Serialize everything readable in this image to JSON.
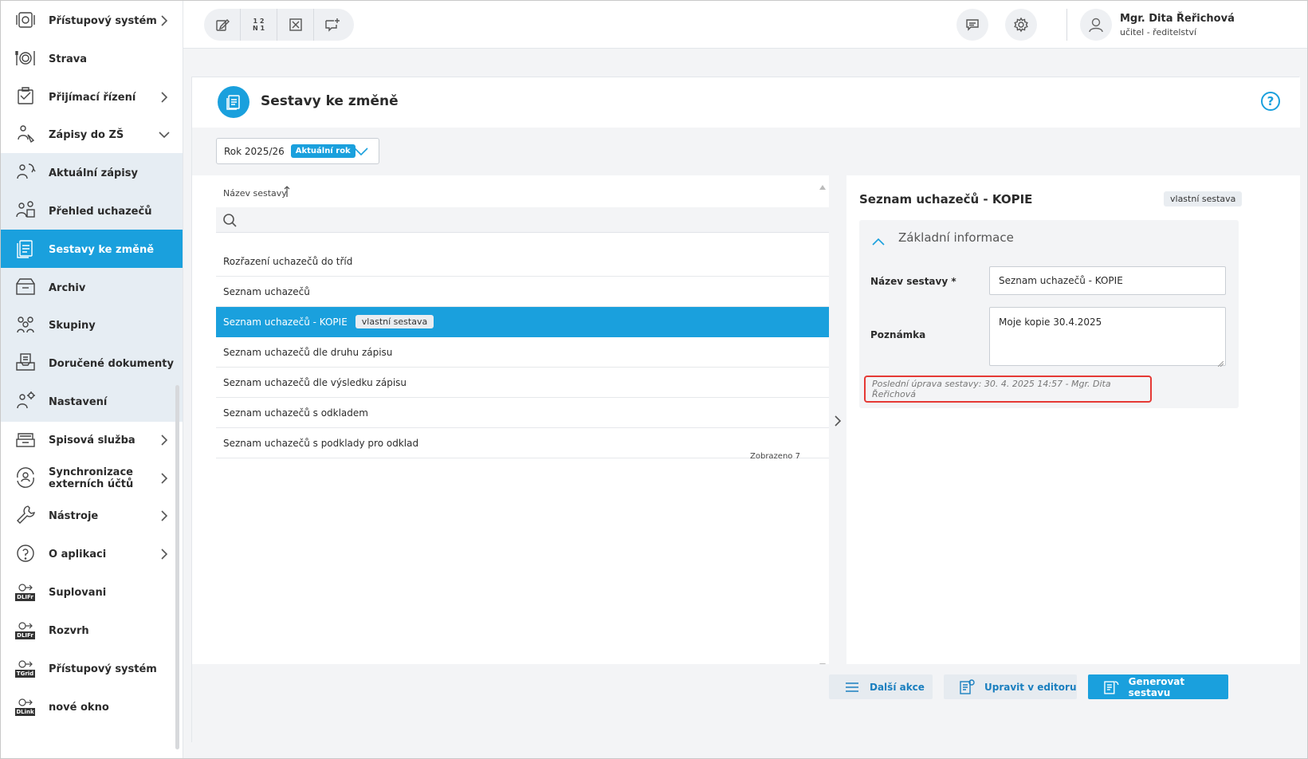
{
  "sidebar": {
    "items": [
      {
        "label": "Přístupový systém",
        "icon": "access-system-icon",
        "chevron": "right",
        "state": "normal"
      },
      {
        "label": "Strava",
        "icon": "meal-plate-icon",
        "chevron": "",
        "state": "normal"
      },
      {
        "label": "Přijímací řízení",
        "icon": "admission-icon",
        "chevron": "right",
        "state": "normal"
      },
      {
        "label": "Zápisy do ZŠ",
        "icon": "enrollment-icon",
        "chevron": "down",
        "state": "normal"
      },
      {
        "label": "Aktuální zápisy",
        "icon": "current-enrollment-icon",
        "chevron": "",
        "state": "sub"
      },
      {
        "label": "Přehled uchazečů",
        "icon": "applicants-overview-icon",
        "chevron": "",
        "state": "sub"
      },
      {
        "label": "Sestavy ke změně",
        "icon": "report-icon",
        "chevron": "",
        "state": "active"
      },
      {
        "label": "Archiv",
        "icon": "archive-icon",
        "chevron": "",
        "state": "sub"
      },
      {
        "label": "Skupiny",
        "icon": "groups-icon",
        "chevron": "",
        "state": "sub"
      },
      {
        "label": "Doručené dokumenty",
        "icon": "inbox-documents-icon",
        "chevron": "",
        "state": "sub"
      },
      {
        "label": "Nastavení",
        "icon": "settings-user-icon",
        "chevron": "",
        "state": "sub"
      },
      {
        "label": "Spisová služba",
        "icon": "filing-service-icon",
        "chevron": "right",
        "state": "normal"
      },
      {
        "label": "Synchronizace externích účtů",
        "icon": "sync-accounts-icon",
        "chevron": "right",
        "state": "normal"
      },
      {
        "label": "Nástroje",
        "icon": "wrench-icon",
        "chevron": "right",
        "state": "normal"
      },
      {
        "label": "O aplikaci",
        "icon": "question-icon",
        "chevron": "right",
        "state": "normal"
      },
      {
        "label": "Suplovani",
        "icon": "dlifr-icon",
        "chevron": "",
        "state": "normal",
        "badge": "DLIFr"
      },
      {
        "label": "Rozvrh",
        "icon": "dlifr-icon",
        "chevron": "",
        "state": "normal",
        "badge": "DLIFr"
      },
      {
        "label": "Přístupový systém",
        "icon": "tgrid-icon",
        "chevron": "",
        "state": "normal",
        "badge": "TGrid"
      },
      {
        "label": "nové okno",
        "icon": "dlink-icon",
        "chevron": "",
        "state": "normal",
        "badge": "DLink"
      }
    ]
  },
  "topbar": {
    "tools": [
      {
        "icon": "edit-icon"
      },
      {
        "icon": "number-order-icon",
        "text_top": "1 2",
        "text_bottom": "N 1"
      },
      {
        "icon": "close-box-icon"
      },
      {
        "icon": "add-comment-icon"
      }
    ],
    "message_icon": "message-icon",
    "settings_icon": "gear-icon",
    "user": {
      "name": "Mgr. Dita Řeřichová",
      "role": "učitel - ředitelství"
    }
  },
  "page": {
    "title": "Sestavy ke změně",
    "help": "?",
    "year_filter": {
      "label": "Rok 2025/26",
      "badge": "Aktuální rok"
    }
  },
  "list": {
    "column_header": "Název sestavy",
    "search_placeholder": "",
    "rows": [
      {
        "label": "Rozřazení uchazečů do tříd",
        "badge": "",
        "selected": false
      },
      {
        "label": "Seznam uchazečů",
        "badge": "",
        "selected": false
      },
      {
        "label": "Seznam uchazečů - KOPIE",
        "badge": "vlastní sestava",
        "selected": true
      },
      {
        "label": "Seznam uchazečů dle druhu zápisu",
        "badge": "",
        "selected": false
      },
      {
        "label": "Seznam uchazečů dle výsledku zápisu",
        "badge": "",
        "selected": false
      },
      {
        "label": "Seznam uchazečů s odkladem",
        "badge": "",
        "selected": false
      },
      {
        "label": "Seznam uchazečů s podklady pro odklad",
        "badge": "",
        "selected": false
      }
    ],
    "shown_count": "Zobrazeno 7"
  },
  "detail": {
    "title": "Seznam uchazečů - KOPIE",
    "badge": "vlastní sestava",
    "section_title": "Základní informace",
    "name_label": "Název sestavy *",
    "name_value": "Seznam uchazečů - KOPIE",
    "note_label": "Poznámka",
    "note_value": "Moje kopie 30.4.2025",
    "last_edit": "Poslední úprava sestavy: 30. 4. 2025 14:57 - Mgr. Dita Řeřichová"
  },
  "actions": {
    "more": "Další akce",
    "editor": "Upravit v editoru",
    "generate": "Generovat sestavu"
  },
  "colors": {
    "accent": "#1aa0dd",
    "highlight_border": "#e53935",
    "sub_item_bg": "#e6edf3"
  }
}
